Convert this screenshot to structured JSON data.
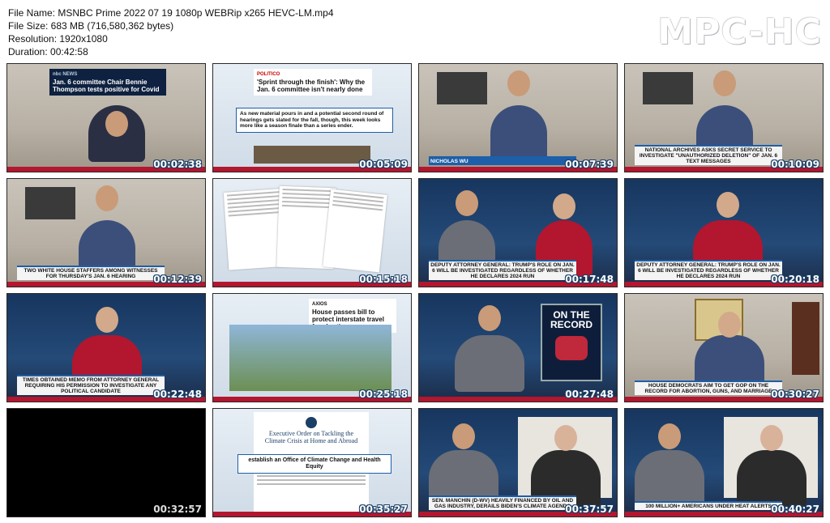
{
  "file_info": {
    "name": "File Name: MSNBC Prime 2022 07 19 1080p WEBRip x265 HEVC-LM.mp4",
    "size": "File Size: 683 MB (716,580,362 bytes)",
    "resolution": "Resolution: 1920x1080",
    "duration": "Duration: 00:42:58"
  },
  "logo": "MPC-HC",
  "thumbnails": [
    {
      "time": "00:02:38",
      "chyron": "",
      "title": "Jan. 6 committee Chair Bennie Thompson tests positive for Covid",
      "source": "nbc NEWS"
    },
    {
      "time": "00:05:09",
      "chyron": "",
      "title": "'Sprint through the finish': Why the Jan. 6 committee isn't nearly done",
      "source": "POLITICO",
      "quote": "As new material pours in and a potential second round of hearings gets slated for the fall, though, this week looks more like a season finale than a series ender."
    },
    {
      "time": "00:07:39",
      "chyron": "NICHOLAS WU",
      "source": "POLITICO"
    },
    {
      "time": "00:10:09",
      "chyron": "NATIONAL ARCHIVES ASKS SECRET SERVICE TO INVESTIGATE \"UNAUTHORIZED DELETION\" OF JAN. 6 TEXT MESSAGES"
    },
    {
      "time": "00:12:39",
      "chyron": "TWO WHITE HOUSE STAFFERS AMONG WITNESSES FOR THURSDAY'S JAN. 6 HEARING"
    },
    {
      "time": "00:15:18",
      "chyron": ""
    },
    {
      "time": "00:17:48",
      "chyron": "DEPUTY ATTORNEY GENERAL: TRUMP'S ROLE ON JAN. 6 WILL BE INVESTIGATED REGARDLESS OF WHETHER HE DECLARES 2024 RUN"
    },
    {
      "time": "00:20:18",
      "chyron": "DEPUTY ATTORNEY GENERAL: TRUMP'S ROLE ON JAN. 6 WILL BE INVESTIGATED REGARDLESS OF WHETHER HE DECLARES 2024 RUN"
    },
    {
      "time": "00:22:48",
      "chyron": "TIMES OBTAINED MEMO FROM ATTORNEY GENERAL REQUIRING HIS PERMISSION TO INVESTIGATE ANY POLITICAL CANDIDATE"
    },
    {
      "time": "00:25:18",
      "chyron": "",
      "title": "House passes bill to protect interstate travel for abortions",
      "source": "AXIOS"
    },
    {
      "time": "00:27:48",
      "chyron": "",
      "record": "ON THE RECORD"
    },
    {
      "time": "00:30:27",
      "chyron": "HOUSE DEMOCRATS AIM TO GET GOP ON THE RECORD FOR ABORTION, GUNS, AND MARRIAGE"
    },
    {
      "time": "00:32:57",
      "chyron": ""
    },
    {
      "time": "00:35:27",
      "chyron": "",
      "title": "Executive Order on Tackling the Climate Crisis at Home and Abroad",
      "quote": "establish an Office of Climate Change and Health Equity"
    },
    {
      "time": "00:37:57",
      "chyron": "SEN. MANCHIN (D-WV) HEAVILY FINANCED BY OIL AND GAS INDUSTRY, DERAILS BIDEN'S CLIMATE AGENDA"
    },
    {
      "time": "00:40:27",
      "chyron": "100 MILLION+ AMERICANS UNDER HEAT ALERTS"
    }
  ],
  "colors": {
    "accent_blue": "#1d5fa8",
    "msnbc_red": "#b3162f"
  }
}
